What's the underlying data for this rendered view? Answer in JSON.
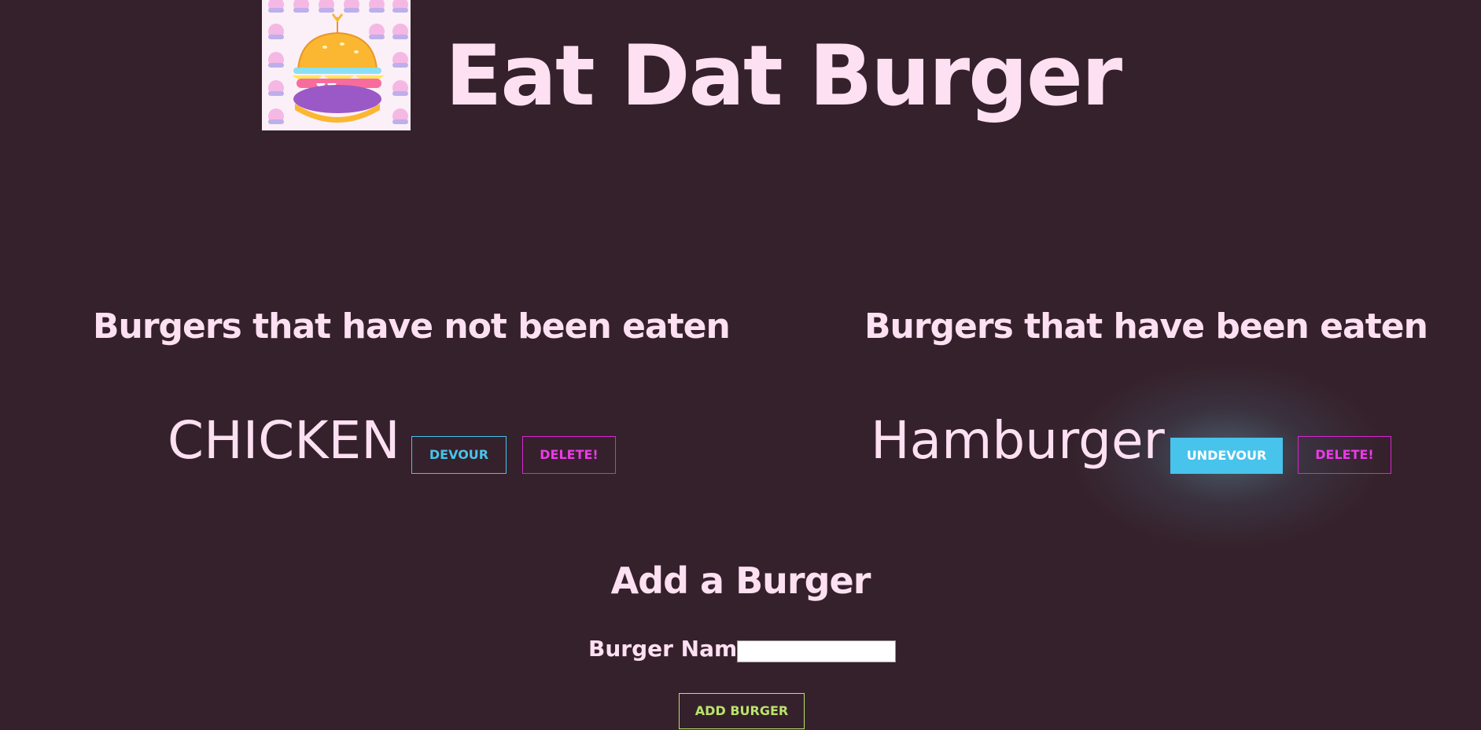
{
  "header": {
    "title": "Eat Dat Burger",
    "logo_icon": "burger-logo-icon"
  },
  "not_eaten": {
    "heading": "Burgers that have not been eaten",
    "items": [
      {
        "name": "CHICKEN",
        "action_label": "DEVOUR",
        "delete_label": "DELETE!"
      }
    ]
  },
  "eaten": {
    "heading": "Burgers that have been eaten",
    "items": [
      {
        "name": "Hamburger",
        "action_label": "UNDEVOUR",
        "delete_label": "DELETE!"
      }
    ]
  },
  "add_form": {
    "heading": "Add a Burger",
    "field_label": "Burger Name",
    "input_value": "",
    "submit_label": "ADD BURGER"
  },
  "colors": {
    "background": "#35212b",
    "text": "#fde0f2",
    "devour": "#47c3ec",
    "delete": "#ec3ae8",
    "add": "#b9e36a"
  }
}
